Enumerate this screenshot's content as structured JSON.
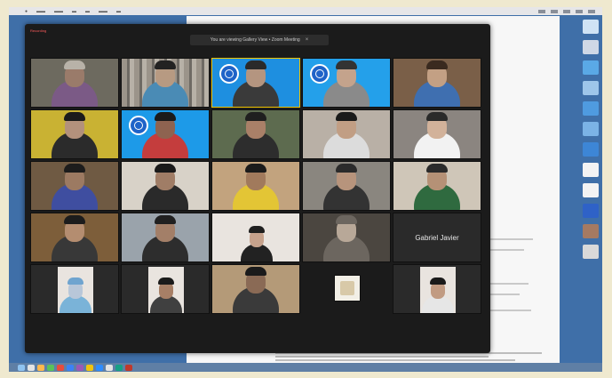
{
  "zoom": {
    "recording_label": "Recording",
    "banner_text": "You are viewing Gallery View • Zoom Meeting",
    "banner_close": "×"
  },
  "participants": [
    {
      "bg": "#6d6a5f",
      "skin": "#9a7b6a",
      "shirt": "#7b5a86",
      "hair": "#b8b2a8"
    },
    {
      "bg": "#8d8d88",
      "skin": "#b79a82",
      "shirt": "#4a8bb5",
      "hair": "#222",
      "shelves": true
    },
    {
      "bg": "#1e8fe0",
      "skin": "#b49580",
      "shirt": "#3a3a3a",
      "hair": "#2a2a2a",
      "badge": true,
      "speaking": true
    },
    {
      "bg": "#24a0ea",
      "skin": "#c4a38c",
      "shirt": "#8a8a8a",
      "hair": "#333",
      "badge": true
    },
    {
      "bg": "#7a5f48",
      "skin": "#c3a084",
      "shirt": "#3f6fb0",
      "hair": "#3a2a1f"
    },
    {
      "bg": "#c9b233",
      "skin": "#b3917c",
      "shirt": "#2b2b2b",
      "hair": "#1b1b1b"
    },
    {
      "bg": "#1d9ae8",
      "skin": "#8e6350",
      "shirt": "#c43d3d",
      "hair": "#1b1b1b",
      "badge": true
    },
    {
      "bg": "#5d6b4f",
      "skin": "#a98068",
      "shirt": "#2d2d2d",
      "hair": "#1f1f1f"
    },
    {
      "bg": "#b9b0a6",
      "skin": "#c19e84",
      "shirt": "#dcdcdc",
      "hair": "#1a1a1a"
    },
    {
      "bg": "#8b8580",
      "skin": "#d2b29a",
      "shirt": "#f2f2f2",
      "hair": "#2a2a2a"
    },
    {
      "bg": "#6f5a43",
      "skin": "#9c7a62",
      "shirt": "#3f4ea0",
      "hair": "#1c1c1c"
    },
    {
      "bg": "#d8d2c8",
      "skin": "#a07d66",
      "shirt": "#2a2a2a",
      "hair": "#1a1a1a"
    },
    {
      "bg": "#c2a37e",
      "skin": "#a17a5c",
      "shirt": "#e3c535",
      "hair": "#1b1b1b"
    },
    {
      "bg": "#8a867f",
      "skin": "#b7947c",
      "shirt": "#333",
      "hair": "#2b2b2b"
    },
    {
      "bg": "#cfc6b8",
      "skin": "#b59176",
      "shirt": "#2f6a3f",
      "hair": "#2b2b2b"
    },
    {
      "bg": "#7d5e3a",
      "skin": "#b48d70",
      "shirt": "#383838",
      "hair": "#1c1c1c"
    },
    {
      "bg": "#9aa3ab",
      "skin": "#a37f68",
      "shirt": "#2d2d2d",
      "hair": "#202020"
    },
    {
      "bg": "#e9e4df",
      "skin": "#c6a28c",
      "shirt": "#222",
      "hair": "#1f1f1f",
      "portrait": true
    },
    {
      "bg": "#4b4640",
      "skin": "#b8a898",
      "shirt": "#6c665f",
      "hair": "#6c665f"
    },
    {
      "bg": "#2a2a2a",
      "name": "Gabriel Javier"
    },
    {
      "bg": "#2a2a2a",
      "skin": "#b8c7d9",
      "shirt": "#7ab3d8",
      "hair": "#6fa4cf",
      "portrait": true
    },
    {
      "bg": "#2a2a2a",
      "skin": "#a77f66",
      "shirt": "#404040",
      "hair": "#1b1b1b",
      "portrait": true
    },
    {
      "bg": "#b49a78",
      "skin": "#8a6a55",
      "shirt": "#3a3a3a",
      "hair": "#1b1b1b"
    },
    {
      "bg": "#2a2a2a",
      "skin": "#d8c9a8",
      "shirt": "#d8c9a8",
      "hair": "#d8c9a8",
      "small": true
    },
    {
      "bg": "#2a2a2a",
      "skin": "#c19b82",
      "shirt": "#e6e6e6",
      "hair": "#1a1a1a",
      "portrait": true
    }
  ]
}
